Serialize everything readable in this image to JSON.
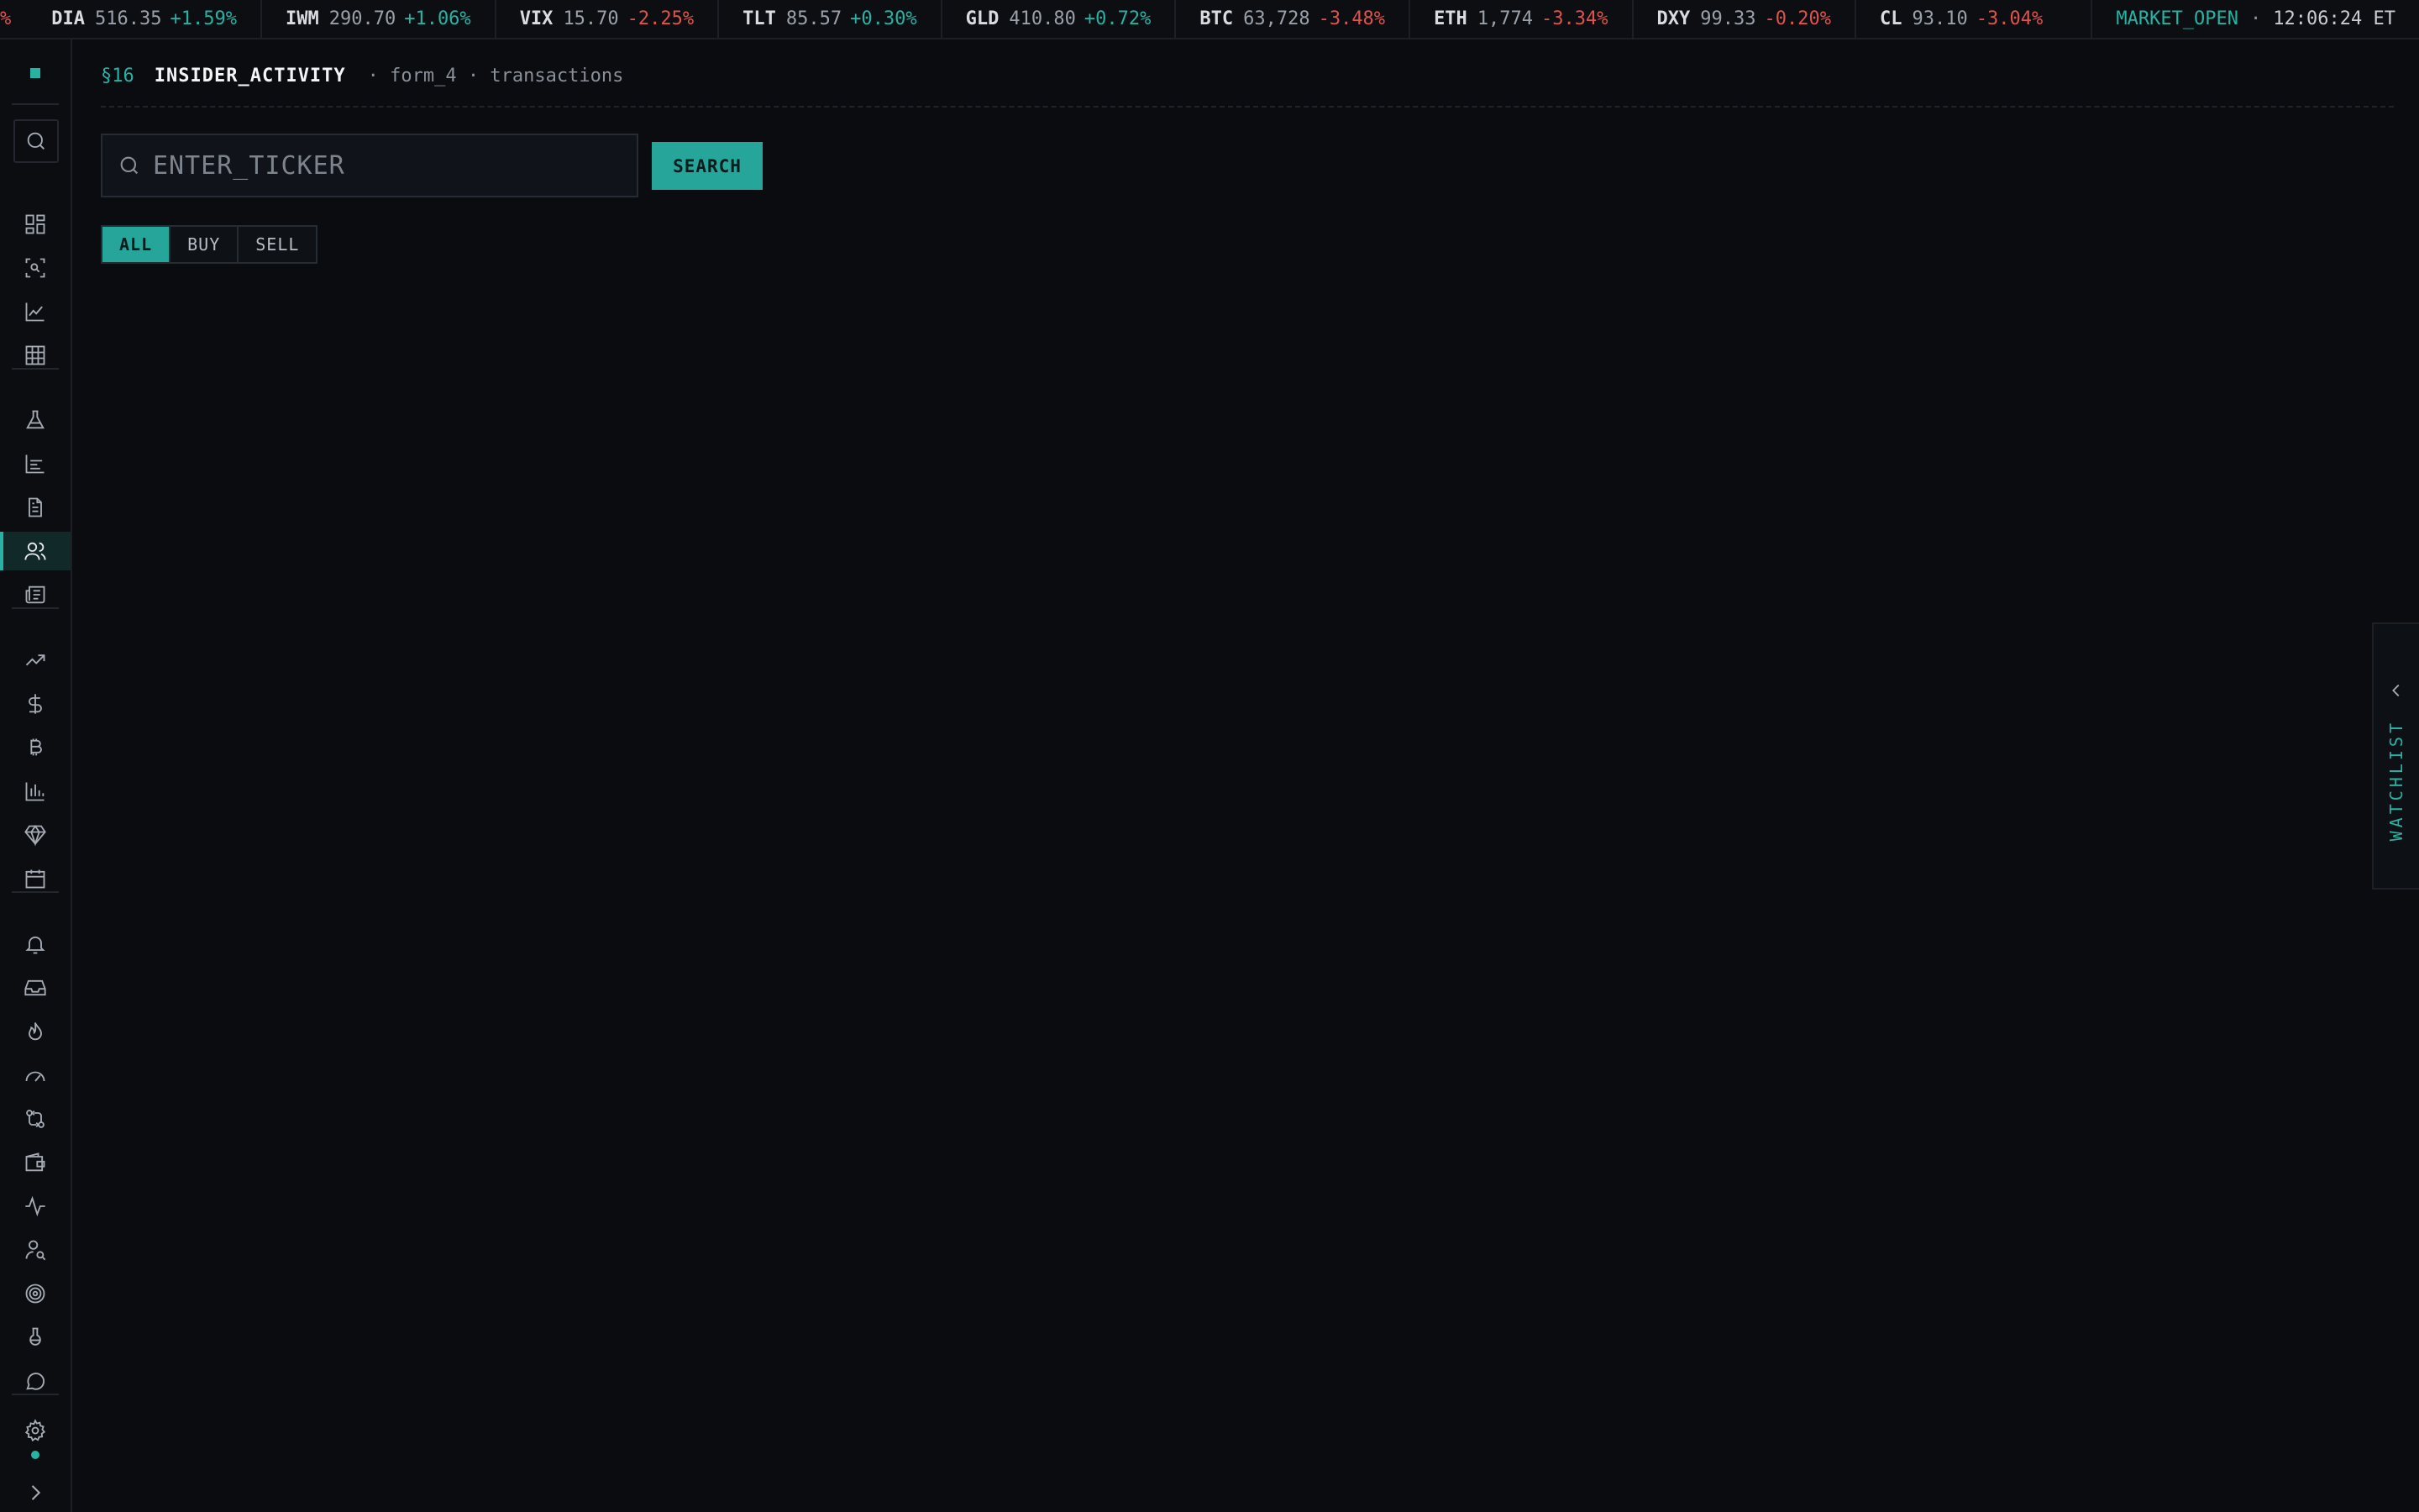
{
  "ticker": {
    "lead_fragment": "%",
    "items": [
      {
        "symbol": "DIA",
        "price": "516.35",
        "change": "+1.59%",
        "direction": "up"
      },
      {
        "symbol": "IWM",
        "price": "290.70",
        "change": "+1.06%",
        "direction": "up"
      },
      {
        "symbol": "VIX",
        "price": "15.70",
        "change": "-2.25%",
        "direction": "down"
      },
      {
        "symbol": "TLT",
        "price": "85.57",
        "change": "+0.30%",
        "direction": "up"
      },
      {
        "symbol": "GLD",
        "price": "410.80",
        "change": "+0.72%",
        "direction": "up"
      },
      {
        "symbol": "BTC",
        "price": "63,728",
        "change": "-3.48%",
        "direction": "down"
      },
      {
        "symbol": "ETH",
        "price": "1,774",
        "change": "-3.34%",
        "direction": "down"
      },
      {
        "symbol": "DXY",
        "price": "99.33",
        "change": "-0.20%",
        "direction": "down"
      },
      {
        "symbol": "CL",
        "price": "93.10",
        "change": "-3.04%",
        "direction": "down"
      }
    ],
    "market_status": "MARKET_OPEN",
    "separator": "·",
    "time": "12:06:24 ET"
  },
  "sidebar": {
    "active": "insiders",
    "icons": [
      "dashboard-icon",
      "scan-icon",
      "chart-line-icon",
      "grid-icon",
      "flask-icon",
      "bar-chart-icon",
      "document-icon",
      "users-icon",
      "newspaper-icon",
      "trending-up-icon",
      "dollar-icon",
      "bitcoin-icon",
      "histogram-icon",
      "gem-icon",
      "calendar-icon",
      "bell-icon",
      "inbox-icon",
      "flame-icon",
      "gauge-icon",
      "swap-icon",
      "wallet-icon",
      "pulse-icon",
      "user-search-icon",
      "target-icon",
      "beaker-icon",
      "chat-icon",
      "gear-icon",
      "expand-icon"
    ]
  },
  "header": {
    "section": "§16",
    "title": "INSIDER_ACTIVITY",
    "meta": "· form_4 · transactions"
  },
  "search": {
    "placeholder": "ENTER_TICKER",
    "value": "",
    "button_label": "SEARCH"
  },
  "filter": {
    "options": [
      "ALL",
      "BUY",
      "SELL"
    ],
    "selected": "ALL"
  },
  "watchlist": {
    "label": "WATCHLIST"
  },
  "colors": {
    "accent": "#26b3a4",
    "up": "#26b3a4",
    "down": "#e0524d",
    "background": "#0a0c0f"
  }
}
